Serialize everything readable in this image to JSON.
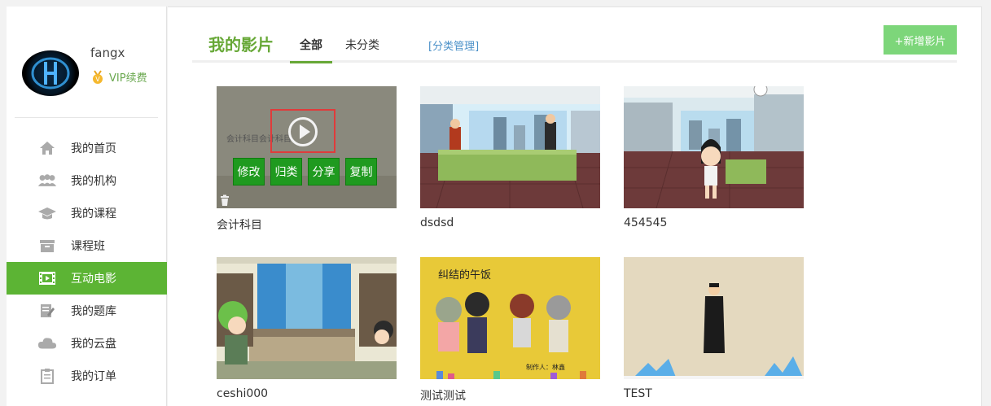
{
  "user": {
    "name": "fangx",
    "vip_label": "VIP续费"
  },
  "sidebar": {
    "items": [
      {
        "label": "我的首页",
        "icon": "home-icon",
        "active": false
      },
      {
        "label": "我的机构",
        "icon": "people-icon",
        "active": false
      },
      {
        "label": "我的课程",
        "icon": "graduation-cap-icon",
        "active": false
      },
      {
        "label": "课程班",
        "icon": "archive-box-icon",
        "active": false
      },
      {
        "label": "互动电影",
        "icon": "film-icon",
        "active": true
      },
      {
        "label": "我的题库",
        "icon": "edit-doc-icon",
        "active": false
      },
      {
        "label": "我的云盘",
        "icon": "cloud-icon",
        "active": false
      },
      {
        "label": "我的订单",
        "icon": "clipboard-icon",
        "active": false
      }
    ]
  },
  "header": {
    "title": "我的影片",
    "tabs": [
      {
        "label": "全部",
        "active": true
      },
      {
        "label": "未分类",
        "active": false
      }
    ],
    "category_manage": "[分类管理]",
    "add_button": "+新增影片"
  },
  "films": [
    {
      "title": "会计科目",
      "overlay_text": "会计科目会计科目",
      "hover": true
    },
    {
      "title": "dsdsd"
    },
    {
      "title": "454545"
    },
    {
      "title": "ceshi000"
    },
    {
      "title": "测试测试",
      "thumb_text": "纠结的午饭",
      "thumb_credit": "制作人：林鑫"
    },
    {
      "title": "TEST"
    }
  ],
  "film_actions": [
    "修改",
    "归类",
    "分享",
    "复制"
  ],
  "colors": {
    "accent": "#5cb434",
    "title_green": "#67a837",
    "add_button": "#7dd67a",
    "action_green": "#1f9a1f",
    "highlight_red": "#e03b3b"
  }
}
